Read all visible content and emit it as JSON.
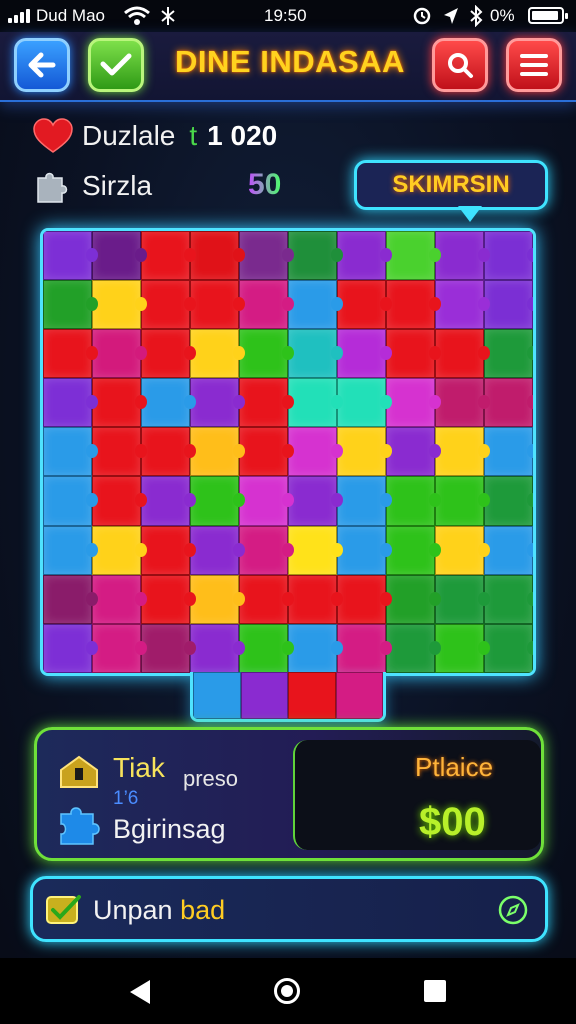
{
  "status_bar": {
    "carrier": "Dud Mao",
    "time": "19:50",
    "battery": "0%"
  },
  "header": {
    "title": "DINE INDASAA",
    "back_icon": "arrow-left-icon",
    "check_icon": "check-icon",
    "search_icon": "search-icon",
    "menu_icon": "menu-icon"
  },
  "stats": {
    "row1": {
      "label": "Duzlale",
      "t": "t",
      "value": "1 020"
    },
    "row2": {
      "label": "Sirzla",
      "value": "50"
    }
  },
  "bubble": {
    "label": "SKIMRSIN"
  },
  "panel": {
    "left": {
      "title": "Tiak",
      "sub": "preso",
      "code": "1’6",
      "label": "Bgirinsag"
    },
    "right": {
      "title": "Ptlaice",
      "price": "$00"
    }
  },
  "bottom_bar": {
    "label_main": "Unpan ",
    "label_accent": "bad"
  },
  "colors": {
    "purple": "#8b2be0",
    "red": "#e8141c",
    "yellow": "#ffd21a",
    "green": "#2ec21a",
    "teal": "#1ec8b0",
    "blue": "#1e8ae0",
    "magenta": "#b51c8a",
    "orange": "#ff5a14"
  },
  "board": {
    "rows": [
      [
        "#7d2fd6",
        "#6a1c8a",
        "#e8141c",
        "#e01218",
        "#7a2a8e",
        "#1f8f3a",
        "#8a2bd0",
        "#4ad12e",
        "#8a2bd0",
        "#7b2fd4"
      ],
      [
        "#22a028",
        "#ffd21a",
        "#e8141c",
        "#e8141c",
        "#d41c84",
        "#2a9be8",
        "#e8141c",
        "#e8141c",
        "#9a2ed8",
        "#7b2fd4"
      ],
      [
        "#e8141c",
        "#d31a7c",
        "#e8141c",
        "#ffd21a",
        "#2ec21a",
        "#1fc0c0",
        "#b52cd8",
        "#e8141c",
        "#e8141c",
        "#1e9a3a"
      ],
      [
        "#7d2fd6",
        "#e8141c",
        "#2a9be8",
        "#8a2bd0",
        "#e8141c",
        "#22e0b8",
        "#22e0b8",
        "#d632d0",
        "#c01c6c",
        "#c01c6c"
      ],
      [
        "#2a9be8",
        "#e8141c",
        "#e8141c",
        "#ffbe1a",
        "#e8141c",
        "#d632d0",
        "#ffd21a",
        "#8a2bd0",
        "#ffd21a",
        "#2a9be8"
      ],
      [
        "#2a9be8",
        "#e8141c",
        "#8a2bd0",
        "#2ec21a",
        "#d632d0",
        "#8a2bd0",
        "#2a9be8",
        "#2ec21a",
        "#2ec21a",
        "#1e9a3a"
      ],
      [
        "#2a9be8",
        "#ffd21a",
        "#e8141c",
        "#8a2bd0",
        "#d41c84",
        "#ffe21a",
        "#2a9be8",
        "#2ec21a",
        "#ffd21a",
        "#2a9be8"
      ],
      [
        "#8a1c6a",
        "#d41c84",
        "#e8141c",
        "#ffbe1a",
        "#e8141c",
        "#e8141c",
        "#e8141c",
        "#22a028",
        "#1e9a3a",
        "#1e9a3a"
      ],
      [
        "#7d2fd6",
        "#d41c84",
        "#a01c6a",
        "#8a2bd0",
        "#2ec21a",
        "#2a9be8",
        "#d41c84",
        "#1e9a3a",
        "#2ec21a",
        "#1e9a3a"
      ]
    ],
    "tab": [
      "#2a9be8",
      "#8a2bd0",
      "#e8141c",
      "#d41c84"
    ]
  }
}
